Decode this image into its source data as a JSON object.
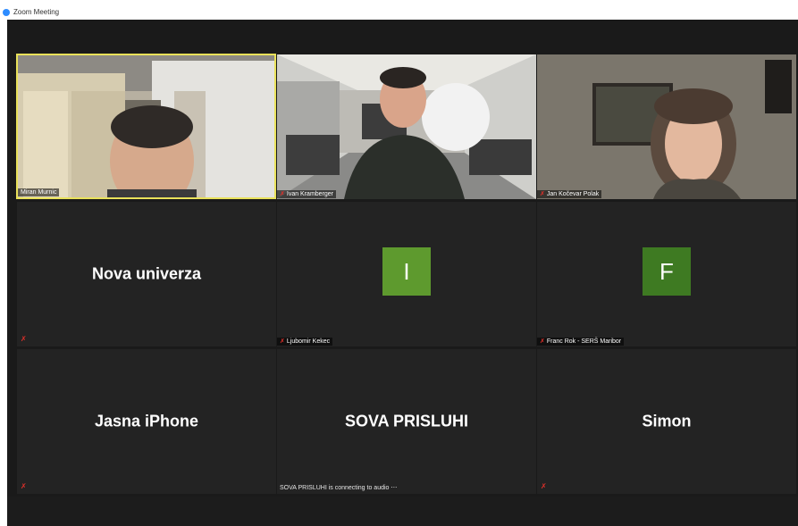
{
  "window": {
    "title": "Zoom Meeting"
  },
  "participants": [
    {
      "name": "Miran Murnic",
      "type": "video"
    },
    {
      "name": "Ivan Kramberger",
      "type": "video"
    },
    {
      "name": "Jan Kočevar Polak",
      "type": "video"
    },
    {
      "name": "Nova univerza",
      "type": "name"
    },
    {
      "name": "Ljubomir Kekec",
      "type": "avatar",
      "initial": "I",
      "color": "#5e9a2e"
    },
    {
      "name": "Franc Rok - SERŠ Maribor",
      "type": "avatar",
      "initial": "F",
      "color": "#3e7a22"
    },
    {
      "name": "Jasna iPhone",
      "type": "name"
    },
    {
      "name": "SOVA PRISLUHI",
      "type": "name",
      "status": "SOVA PRISLUHI is connecting to audio ⋯"
    },
    {
      "name": "Simon",
      "type": "name"
    }
  ],
  "colors": {
    "active_speaker_border": "#e9e15a",
    "muted_mic": "#e0302a",
    "zoom_blue": "#2d8cff"
  }
}
